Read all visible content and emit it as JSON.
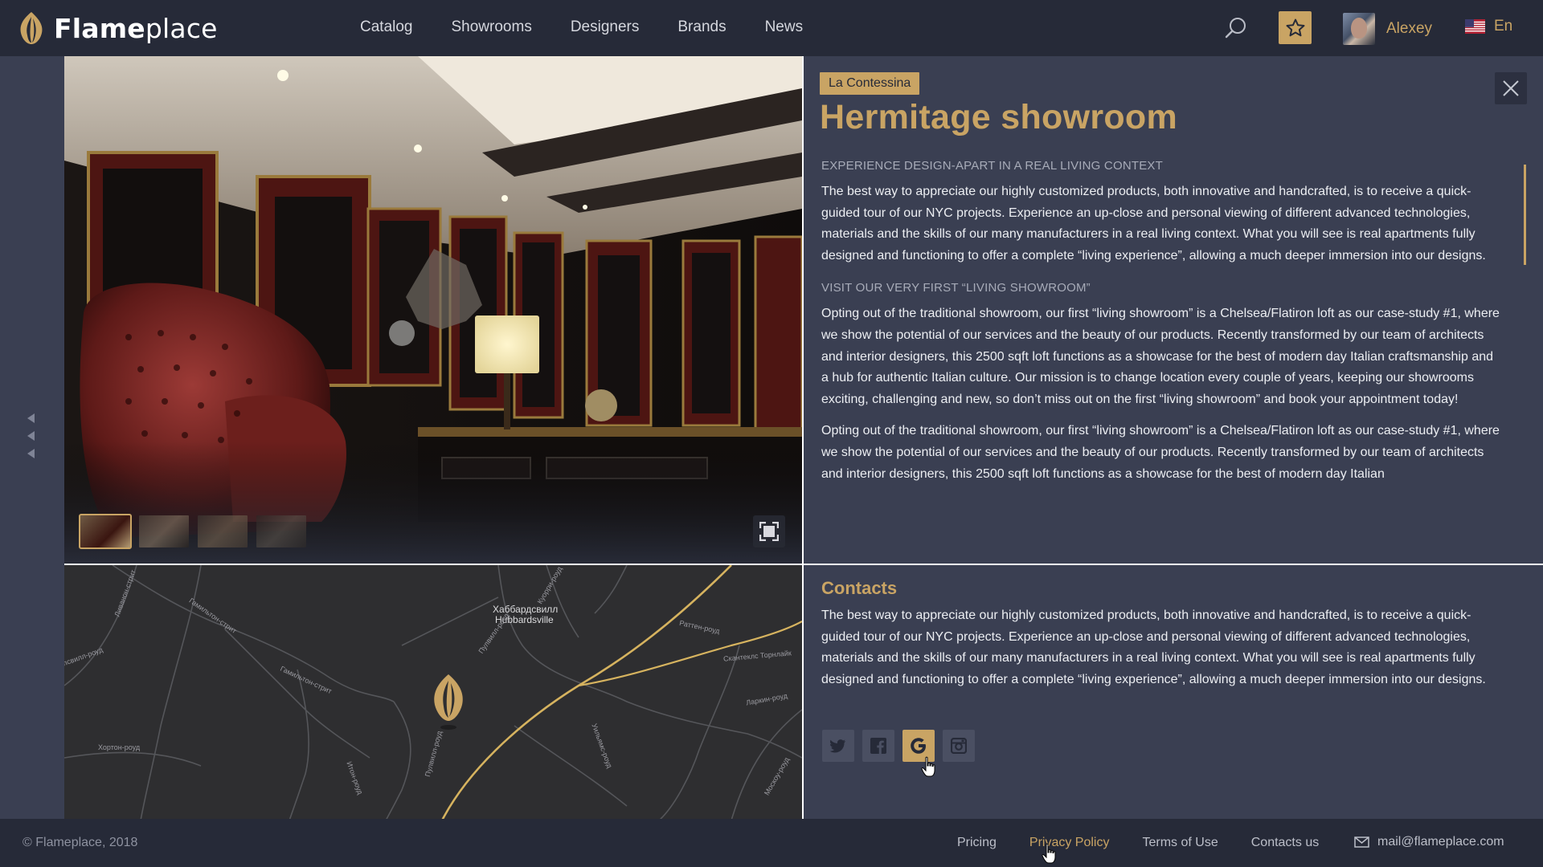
{
  "header": {
    "logo_bold": "Flame",
    "logo_light": "place",
    "nav": [
      "Catalog",
      "Showrooms",
      "Designers",
      "Brands",
      "News"
    ],
    "user_name": "Alexey",
    "language": "En"
  },
  "showroom": {
    "brand_tag": "La Contessina",
    "title": "Hermitage showroom",
    "sections": [
      {
        "heading": "Experience design-apart in a real living context",
        "text": "The best way to appreciate our highly customized products, both innovative and handcrafted, is to receive a quick-guided tour of our NYC projects. Experience an up-close and personal viewing of different advanced technologies, materials and the skills of our many manufacturers in a real living context. What you will see is real apartments fully designed and functioning to offer a complete “living experience”, allowing a much deeper immersion into our designs."
      },
      {
        "heading": "Visit our very first “living showroom”",
        "text": "Opting out of the traditional showroom, our first “living showroom” is a Chelsea/Flatiron loft as our case-study #1, where we show the potential of our services and the beauty of our products. Recently transformed by our team of architects and interior designers, this 2500 sqft loft functions as a showcase for the best of modern day Italian craftsmanship and a hub for authentic Italian culture. Our mission is to change location every couple of years, keeping our showrooms exciting, challenging and new, so don’t miss out on the first “living showroom” and book your appointment today!"
      },
      {
        "heading": "",
        "text": "Opting out of the traditional showroom, our first “living showroom” is a Chelsea/Flatiron loft as our case-study #1, where we show the potential of our services and the beauty of our products. Recently transformed by our team of architects and interior designers, this 2500 sqft loft functions as a showcase for the best of modern day Italian"
      }
    ]
  },
  "contacts": {
    "title": "Contacts",
    "text": "The best way to appreciate our highly customized products, both innovative and handcrafted, is to receive a quick-guided tour of our NYC projects. Experience an up-close and personal viewing of different advanced technologies, materials and the skills of our many manufacturers in a real living context. What you will see is real apartments fully designed and functioning to offer a complete “living experience”, allowing a much deeper immersion into our designs.",
    "socials": [
      "twitter-icon",
      "facebook-icon",
      "google-icon",
      "instagram-icon"
    ]
  },
  "map": {
    "labels": [
      "Хаббардсвилл",
      "Hubbardsville",
      "Гамильтон-стрит",
      "Гамильтон-стрит",
      "Пулвилл-роуд",
      "Куорри-роуд",
      "Раттен-роуд",
      "Скантеклс Торнлайк",
      "Ларкин-роуд",
      "Москоу-роуд",
      "Хортон-роуд",
      "Ливанон-стрит",
      "Олсвилл-роуд",
      "Пулвилл-роуд",
      "Уильямс-роуд",
      "Итон-роуд"
    ]
  },
  "footer": {
    "copyright": "© Flameplace, 2018",
    "links": [
      "Pricing",
      "Privacy Policy",
      "Terms of Use",
      "Contacts us"
    ],
    "email": "mail@flameplace.com"
  },
  "colors": {
    "accent": "#c9a464",
    "background": "#3a3f52",
    "header": "#262a38"
  }
}
